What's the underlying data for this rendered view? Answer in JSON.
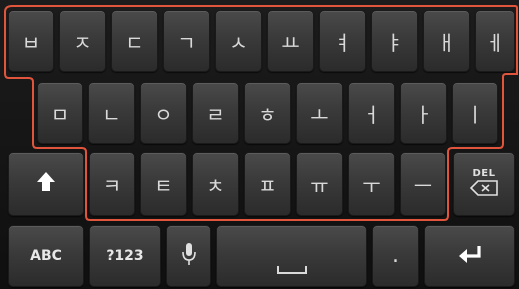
{
  "colors": {
    "outline": "#e0553c",
    "key_text": "#d9d9d9",
    "background": "#141414"
  },
  "rows": {
    "row1": [
      "ㅂ",
      "ㅈ",
      "ㄷ",
      "ㄱ",
      "ㅅ",
      "ㅛ",
      "ㅕ",
      "ㅑ",
      "ㅐ",
      "ㅔ"
    ],
    "row2": [
      "ㅁ",
      "ㄴ",
      "ㅇ",
      "ㄹ",
      "ㅎ",
      "ㅗ",
      "ㅓ",
      "ㅏ",
      "ㅣ"
    ],
    "row3": [
      "ㅋ",
      "ㅌ",
      "ㅊ",
      "ㅍ",
      "ㅠ",
      "ㅜ",
      "ㅡ"
    ]
  },
  "special": {
    "shift_icon": "shift-arrow-icon",
    "delete_label": "DEL",
    "delete_icon": "backspace-icon",
    "abc_label": "ABC",
    "symbols_label": "?123",
    "mic_icon": "microphone-icon",
    "space_icon": "space-icon",
    "period_label": ".",
    "enter_icon": "enter-arrow-icon"
  }
}
